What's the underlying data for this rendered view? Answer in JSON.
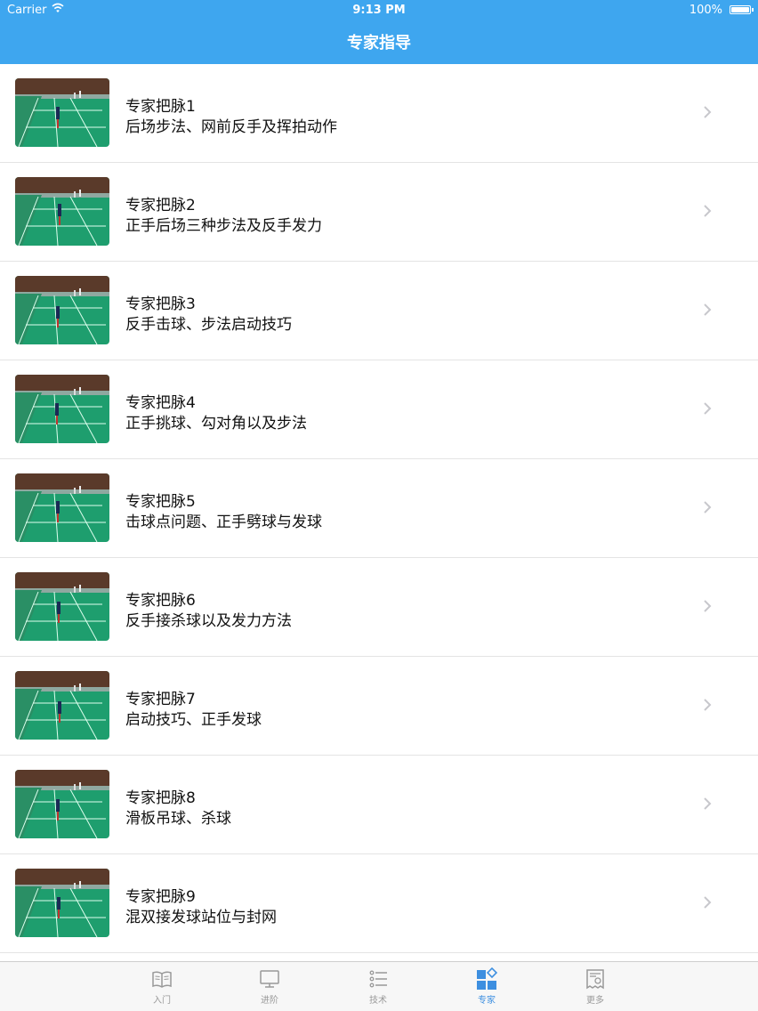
{
  "status_bar": {
    "carrier": "Carrier",
    "time": "9:13 PM",
    "battery": "100%"
  },
  "nav": {
    "title": "专家指导"
  },
  "items": [
    {
      "title": "专家把脉1",
      "subtitle": "后场步法、网前反手及挥拍动作"
    },
    {
      "title": "专家把脉2",
      "subtitle": "正手后场三种步法及反手发力"
    },
    {
      "title": "专家把脉3",
      "subtitle": "反手击球、步法启动技巧"
    },
    {
      "title": "专家把脉4",
      "subtitle": "正手挑球、勾对角以及步法"
    },
    {
      "title": "专家把脉5",
      "subtitle": "击球点问题、正手劈球与发球"
    },
    {
      "title": "专家把脉6",
      "subtitle": "反手接杀球以及发力方法"
    },
    {
      "title": "专家把脉7",
      "subtitle": "启动技巧、正手发球"
    },
    {
      "title": "专家把脉8",
      "subtitle": "滑板吊球、杀球"
    },
    {
      "title": "专家把脉9",
      "subtitle": "混双接发球站位与封网"
    }
  ],
  "tabs": [
    {
      "label": "入门",
      "icon": "book-icon"
    },
    {
      "label": "进阶",
      "icon": "monitor-icon"
    },
    {
      "label": "技术",
      "icon": "list-icon"
    },
    {
      "label": "专家",
      "icon": "grid-icon",
      "active": true
    },
    {
      "label": "更多",
      "icon": "certificate-icon"
    }
  ],
  "colors": {
    "accent": "#3ea6ef",
    "active_tab": "#3d8fe0",
    "inactive_tab": "#999999"
  }
}
